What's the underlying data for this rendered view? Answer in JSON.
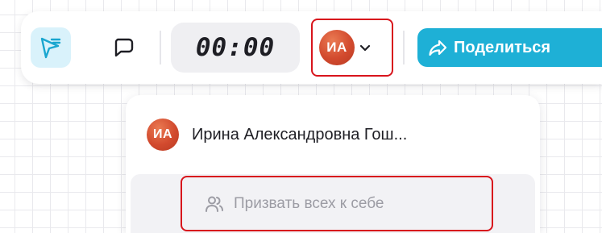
{
  "toolbar": {
    "select_tool_icon": "pointer-icon",
    "comment_tool_icon": "comment-icon",
    "timer": "00:00",
    "user_initials": "ИА",
    "share_label": "Поделиться",
    "share_icon": "share-arrow-icon"
  },
  "dropdown": {
    "user_initials": "ИА",
    "user_name": "Ирина Александровна Гош...",
    "summon_label": "Призвать всех к себе",
    "summon_icon": "users-icon"
  },
  "colors": {
    "accent": "#1eb0d6",
    "active_tool_bg": "#d9f2fb",
    "avatar": "#d24a2e",
    "highlight": "#d8141c"
  }
}
